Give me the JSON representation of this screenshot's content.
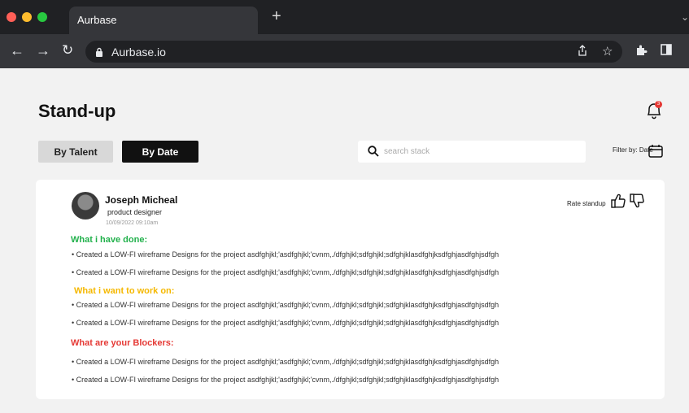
{
  "browser": {
    "tab_title": "Aurbase",
    "new_tab_label": "+",
    "url": "Aurbase.io"
  },
  "page": {
    "title": "Stand-up",
    "notification_count": "3"
  },
  "view_toggle": {
    "by_talent": "By Talent",
    "by_date": "By Date",
    "selected": "By Date"
  },
  "search": {
    "placeholder": "search stack",
    "value": ""
  },
  "filter": {
    "label": "Filter by: Date"
  },
  "standup": {
    "user": {
      "name": "Joseph Micheal",
      "role": "product designer",
      "timestamp": "10/09/2022  09:10am"
    },
    "rate_label": "Rate standup",
    "sections": [
      {
        "title": "What i have done:",
        "color": "#22b14c",
        "items": [
          "•  Created a LOW-FI wireframe Designs for the project asdfghjkl;'asdfghjkl;'cvnm,./dfghjkl;sdfghjkl;sdfghjklasdfghjksdfghjasdfghjsdfgh",
          "•  Created a LOW-FI wireframe Designs for the project asdfghjkl;'asdfghjkl;'cvnm,./dfghjkl;sdfghjkl;sdfghjklasdfghjksdfghjasdfghjsdfgh"
        ]
      },
      {
        "title": "What i want to work on:",
        "color": "#f5b800",
        "items": [
          "•  Created a LOW-FI wireframe Designs for the project asdfghjkl;'asdfghjkl;'cvnm,./dfghjkl;sdfghjkl;sdfghjklasdfghjksdfghjasdfghjsdfgh",
          "•  Created a LOW-FI wireframe Designs for the project asdfghjkl;'asdfghjkl;'cvnm,./dfghjkl;sdfghjkl;sdfghjklasdfghjksdfghjasdfghjsdfgh"
        ]
      },
      {
        "title": "What are your Blockers:",
        "color": "#e53935",
        "items": [
          "•  Created a LOW-FI wireframe Designs for the project asdfghjkl;'asdfghjkl;'cvnm,./dfghjkl;sdfghjkl;sdfghjklasdfghjksdfghjasdfghjsdfgh",
          "•  Created a LOW-FI wireframe Designs for the project asdfghjkl;'asdfghjkl;'cvnm,./dfghjkl;sdfghjkl;sdfghjklasdfghjksdfghjasdfghjsdfgh"
        ]
      }
    ]
  }
}
